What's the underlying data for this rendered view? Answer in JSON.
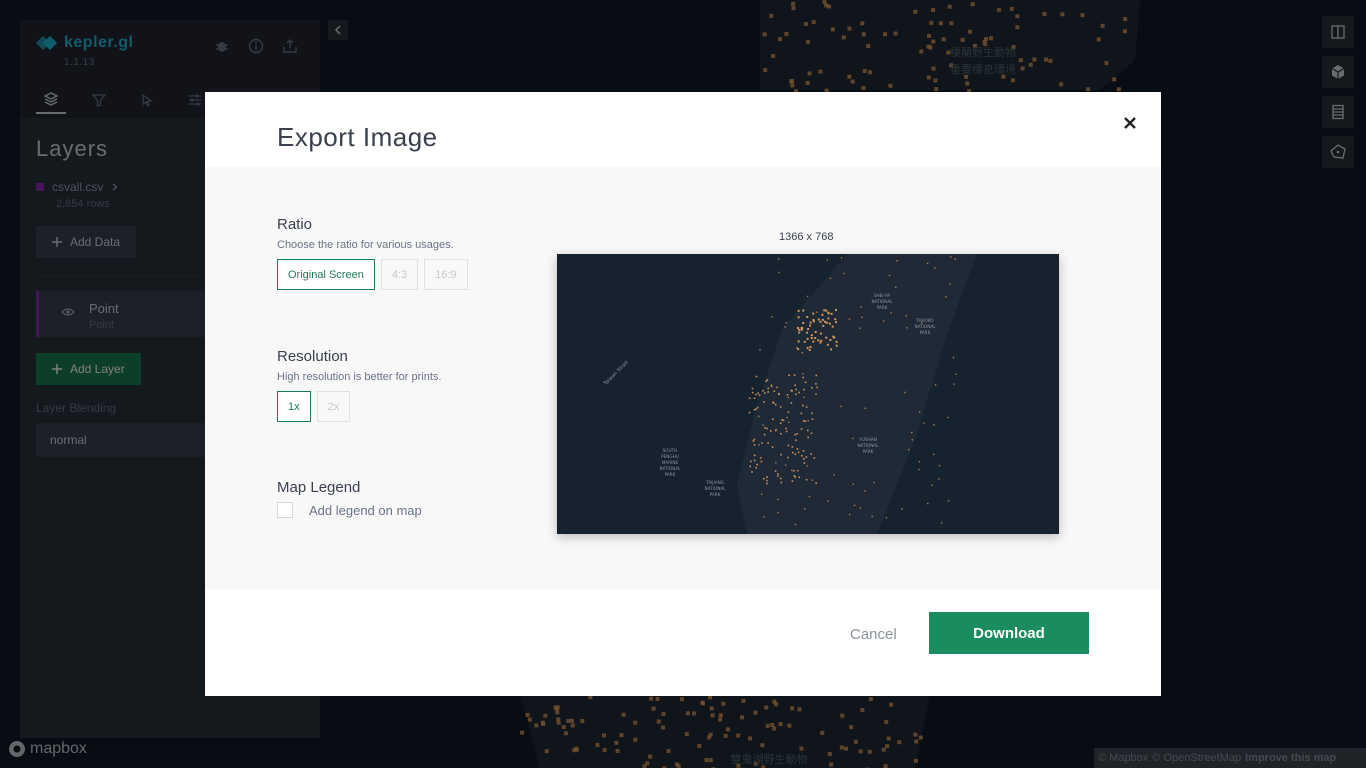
{
  "app": {
    "name": "kepler.gl",
    "version": "1.1.13"
  },
  "side_panel": {
    "title": "Layers",
    "dataset": {
      "name": "csvall.csv",
      "rows": "2,854 rows"
    },
    "add_data_label": "Add Data",
    "layer": {
      "name": "Point",
      "type": "Point"
    },
    "add_layer_label": "Add Layer",
    "blending_label": "Layer Blending",
    "blending_value": "normal"
  },
  "map": {
    "label_top_line1": "棲蘭野生動物",
    "label_top_line2": "重要棲息環境",
    "label_bottom": "雙鬼湖野生動物",
    "mapbox_text": "mapbox",
    "attribution": {
      "mapbox": "© Mapbox",
      "osm": "© OpenStreetMap",
      "improve": "Improve this map"
    }
  },
  "modal": {
    "title": "Export Image",
    "ratio": {
      "title": "Ratio",
      "desc": "Choose the ratio for various usages.",
      "options": [
        "Original Screen",
        "4:3",
        "16:9"
      ],
      "selected": "Original Screen"
    },
    "resolution": {
      "title": "Resolution",
      "desc": "High resolution is better for prints.",
      "options": [
        "1x",
        "2x"
      ],
      "selected": "1x"
    },
    "legend": {
      "title": "Map Legend",
      "checkbox_label": "Add legend on map",
      "checked": false
    },
    "preview_size": "1366 x 768",
    "preview_labels": {
      "shei_pa_1": "SHEI-PA",
      "shei_pa_2": "NATIONAL",
      "shei_pa_3": "PARK",
      "taroko_1": "TAROKO",
      "taroko_2": "NATIONAL",
      "taroko_3": "PARK",
      "yushan_1": "YUSHAN",
      "yushan_2": "NATIONAL",
      "yushan_3": "PARK",
      "penghu_1": "SOUTH",
      "penghu_2": "PENGHU",
      "penghu_3": "MARINE",
      "penghu_4": "NATIONAL",
      "penghu_5": "PARK",
      "taijiang_1": "TAIJIANG",
      "taijiang_2": "NATIONAL",
      "taijiang_3": "PARK",
      "strait": "Taiwan Strait"
    },
    "cancel_label": "Cancel",
    "download_label": "Download"
  },
  "colors": {
    "accent": "#1b7d55",
    "kepler_blue": "#1fbad6",
    "dataset": "#8b2fb0",
    "points": "#e8a15c"
  }
}
